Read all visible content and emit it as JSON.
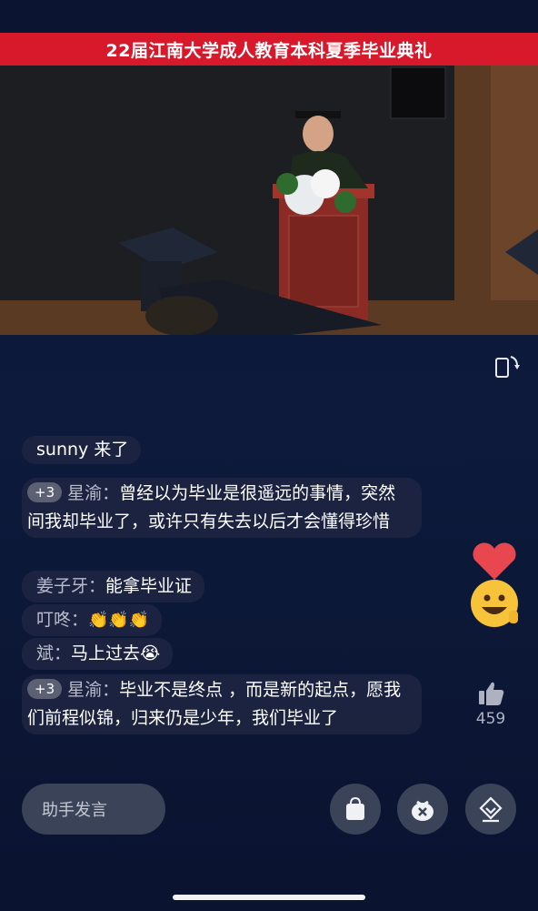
{
  "banner": {
    "title": "22届江南大学成人教育本科夏季毕业典礼"
  },
  "chat": {
    "join": {
      "user": "sunny",
      "text": "来了"
    },
    "messages": [
      {
        "badge": "+3",
        "user": "星渝：",
        "text": "曾经以为毕业是很遥远的事情，突然间我却毕业了，或许只有失去以后才会懂得珍惜"
      },
      {
        "user": "姜子牙：",
        "text": "能拿毕业证"
      },
      {
        "user": "叮咚：",
        "text": "👏👏👏"
      },
      {
        "user": "斌：",
        "text": "马上过去😭"
      },
      {
        "badge": "+3",
        "user": "星渝：",
        "text": "毕业不是终点 ，而是新的起点，愿我们前程似锦，归来仍是少年，我们毕业了"
      }
    ]
  },
  "likes": {
    "count": "459"
  },
  "input": {
    "placeholder": "助手发言"
  },
  "icons": {
    "shop": "shopping-bag-icon",
    "gift": "gift-bag-icon",
    "share": "share-diamond-icon",
    "rotate": "rotate-screen-icon",
    "like": "thumbs-up-icon"
  }
}
